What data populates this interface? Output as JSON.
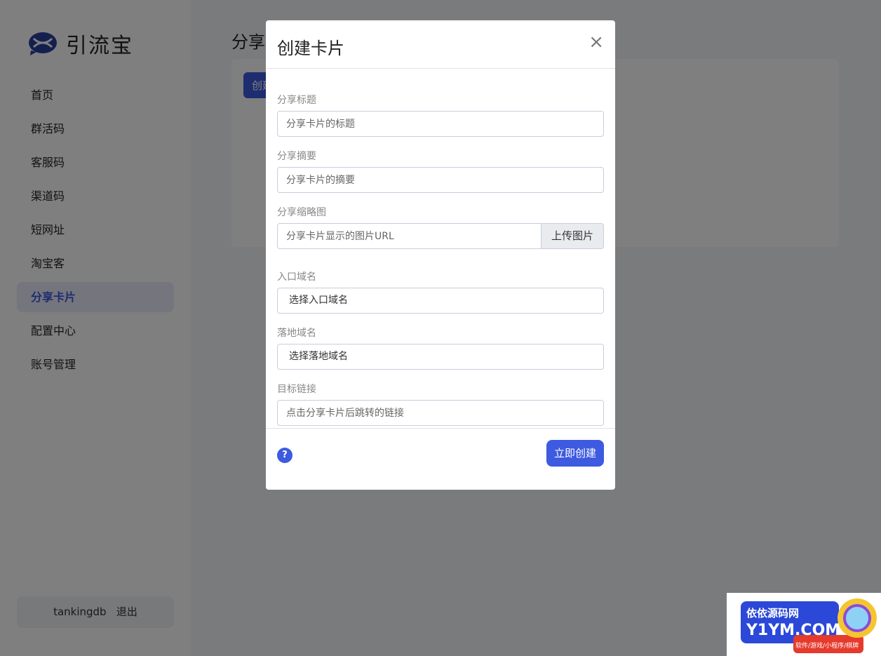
{
  "sidebar": {
    "brand": "引流宝",
    "items": [
      {
        "label": "首页"
      },
      {
        "label": "群活码"
      },
      {
        "label": "客服码"
      },
      {
        "label": "渠道码"
      },
      {
        "label": "短网址"
      },
      {
        "label": "淘宝客"
      },
      {
        "label": "分享卡片",
        "active": true
      },
      {
        "label": "配置中心"
      },
      {
        "label": "账号管理"
      }
    ],
    "user": "tankingdb",
    "logout": "退出"
  },
  "main": {
    "title": "分享卡片",
    "create_label": "创建"
  },
  "modal": {
    "title": "创建卡片",
    "close": "×",
    "fields": {
      "title_label": "分享标题",
      "title_placeholder": "分享卡片的标题",
      "summary_label": "分享摘要",
      "summary_placeholder": "分享卡片的摘要",
      "thumb_label": "分享缩略图",
      "thumb_placeholder": "分享卡片显示的图片URL",
      "upload_label": "上传图片",
      "entry_label": "入口域名",
      "entry_value": "选择入口域名",
      "landing_label": "落地域名",
      "landing_value": "选择落地域名",
      "target_label": "目标链接",
      "target_placeholder": "点击分享卡片后跳转的链接"
    },
    "help": "?",
    "submit": "立即创建"
  },
  "watermark": {
    "line1": "依依源码网",
    "line2": "Y1YM.COM",
    "line3": "软件/游戏/小程序/棋牌"
  },
  "colors": {
    "accent": "#3d5ae0"
  }
}
